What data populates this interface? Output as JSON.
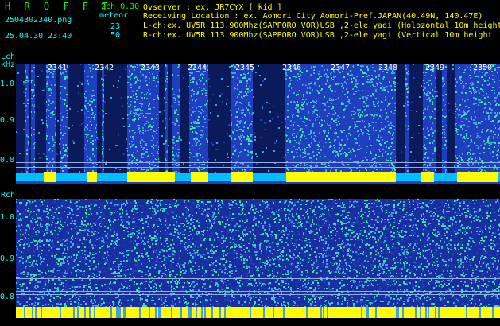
{
  "header": {
    "brand": "H R O F F T",
    "channels": "2ch 0.30",
    "filename": "2504302340.png",
    "mode": "meteor",
    "datetime": "25.04.30 23:40",
    "count_l": "23",
    "count_r": "50"
  },
  "info": {
    "observer": "Ovserver          : ex. JR7CYX [ kid ]",
    "location": "Receiving Location : ex. Aomori City Aomori-Pref.JAPAN(40.49N, 140.47E)",
    "lch": "L-ch:ex. UV5R 113.900Mhz(SAPPORO VOR)USB ,2-ele yagi (Holozontal 10m height",
    "rch": "R-ch:ex. UV5R 113.900Mhz(SAPPORO VOR)USB ,2-ele yagi (Vertical 10m height"
  },
  "lch_panel": {
    "label": "Lch",
    "unit": "kHz",
    "y_ticks": [
      "1.0",
      "0.9",
      "0.8"
    ],
    "x_ticks": [
      "2341",
      "2342",
      "2343",
      "2344",
      "2345",
      "2346",
      "2347",
      "2348",
      "2349",
      "2350"
    ]
  },
  "rch_panel": {
    "label": "Rch",
    "y_ticks": [
      "1.0",
      "0.9",
      "0.8"
    ]
  },
  "colors": {
    "background": "#000000",
    "dark_band": "#0a1a5a",
    "noise_low": "#1f3fbf",
    "noise_mid": "#40a0e0",
    "noise_high": "#40e0a0",
    "signal": "#ffff00",
    "label": "#00ffff"
  }
}
